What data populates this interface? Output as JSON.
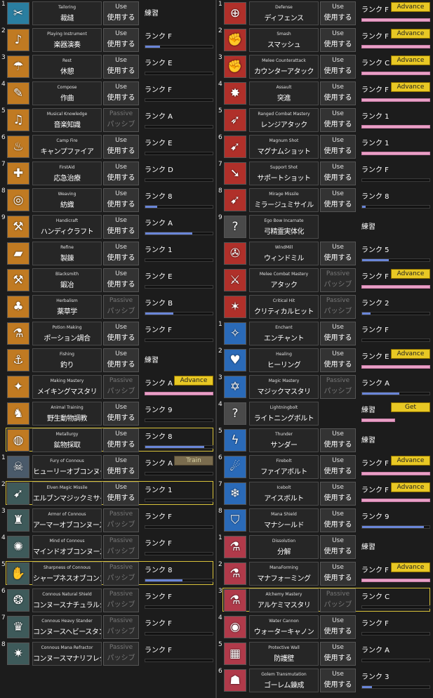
{
  "left": [
    {
      "num": "1",
      "icon": "scissors-icon",
      "glyph": "✂",
      "bg": "#2a7ea0",
      "en": "Tailoring",
      "jp": "裁縫",
      "use_en": "Use",
      "use_jp": "使用する",
      "passive": false,
      "rank": "練習",
      "progress": 0.0,
      "bar": "none",
      "button": ""
    },
    {
      "num": "2",
      "icon": "lute-icon",
      "glyph": "♪",
      "bg": "#c07a22",
      "en": "Playing Instrument",
      "jp": "楽器演奏",
      "use_en": "Use",
      "use_jp": "使用する",
      "passive": false,
      "rank": "ランク F",
      "progress": 0.22,
      "bar": "blue",
      "button": ""
    },
    {
      "num": "3",
      "icon": "rest-umbrella-icon",
      "glyph": "☂",
      "bg": "#c07a22",
      "en": "Rest",
      "jp": "休憩",
      "use_en": "Use",
      "use_jp": "使用する",
      "passive": false,
      "rank": "ランク E",
      "progress": 0.0,
      "bar": "blue",
      "button": ""
    },
    {
      "num": "4",
      "icon": "compose-quill-icon",
      "glyph": "✎",
      "bg": "#c07a22",
      "en": "Compose",
      "jp": "作曲",
      "use_en": "Use",
      "use_jp": "使用する",
      "passive": false,
      "rank": "ランク F",
      "progress": 0.0,
      "bar": "blue",
      "button": ""
    },
    {
      "num": "5",
      "icon": "music-scroll-icon",
      "glyph": "♫",
      "bg": "#c07a22",
      "en": "Musical Knowledge",
      "jp": "音楽知識",
      "use_en": "Passive",
      "use_jp": "パッシブ",
      "passive": true,
      "rank": "ランク A",
      "progress": 0.0,
      "bar": "blue",
      "button": ""
    },
    {
      "num": "6",
      "icon": "campfire-icon",
      "glyph": "♨",
      "bg": "#c07a22",
      "en": "Camp Fire",
      "jp": "キャンプファイア",
      "use_en": "Use",
      "use_jp": "使用する",
      "passive": false,
      "rank": "ランク E",
      "progress": 0.0,
      "bar": "blue",
      "button": ""
    },
    {
      "num": "7",
      "icon": "bandage-icon",
      "glyph": "✚",
      "bg": "#c07a22",
      "en": "FirstAid",
      "jp": "応急治療",
      "use_en": "Use",
      "use_jp": "使用する",
      "passive": false,
      "rank": "ランク D",
      "progress": 0.0,
      "bar": "blue",
      "button": ""
    },
    {
      "num": "8",
      "icon": "yarn-ball-icon",
      "glyph": "◎",
      "bg": "#c07a22",
      "en": "Weaving",
      "jp": "紡織",
      "use_en": "Use",
      "use_jp": "使用する",
      "passive": false,
      "rank": "ランク 8",
      "progress": 0.18,
      "bar": "blue",
      "button": ""
    },
    {
      "num": "9",
      "icon": "handicraft-icon",
      "glyph": "⚒",
      "bg": "#c07a22",
      "en": "Handicraft",
      "jp": "ハンディクラフト",
      "use_en": "Use",
      "use_jp": "使用する",
      "passive": false,
      "rank": "ランク A",
      "progress": 0.7,
      "bar": "blue",
      "button": ""
    },
    {
      "num": "",
      "icon": "refine-ingot-icon",
      "glyph": "▰",
      "bg": "#c07a22",
      "en": "Refine",
      "jp": "製錬",
      "use_en": "Use",
      "use_jp": "使用する",
      "passive": false,
      "rank": "ランク 1",
      "progress": 0.0,
      "bar": "blue",
      "button": ""
    },
    {
      "num": "",
      "icon": "anvil-icon",
      "glyph": "⚒",
      "bg": "#c07a22",
      "en": "Blacksmith",
      "jp": "鍛冶",
      "use_en": "Use",
      "use_jp": "使用する",
      "passive": false,
      "rank": "ランク E",
      "progress": 0.0,
      "bar": "blue",
      "button": ""
    },
    {
      "num": "",
      "icon": "herb-clover-icon",
      "glyph": "♣",
      "bg": "#c07a22",
      "en": "Herbalism",
      "jp": "薬草学",
      "use_en": "Passive",
      "use_jp": "パッシブ",
      "passive": true,
      "rank": "ランク B",
      "progress": 0.42,
      "bar": "blue",
      "button": ""
    },
    {
      "num": "",
      "icon": "potion-flask-icon",
      "glyph": "⚗",
      "bg": "#c07a22",
      "en": "Potion Making",
      "jp": "ポーション調合",
      "use_en": "Use",
      "use_jp": "使用する",
      "passive": false,
      "rank": "ランク F",
      "progress": 0.0,
      "bar": "blue",
      "button": ""
    },
    {
      "num": "",
      "icon": "fishing-rod-icon",
      "glyph": "⚓",
      "bg": "#c07a22",
      "en": "Fishing",
      "jp": "釣り",
      "use_en": "Use",
      "use_jp": "使用する",
      "passive": false,
      "rank": "練習",
      "progress": 0.0,
      "bar": "none",
      "button": ""
    },
    {
      "num": "",
      "icon": "making-tools-icon",
      "glyph": "✦",
      "bg": "#c07a22",
      "en": "Making Mastery",
      "jp": "メイキングマスタリ",
      "use_en": "Passive",
      "use_jp": "パッシブ",
      "passive": true,
      "rank": "ランク A",
      "progress": 0.0,
      "bar": "pink",
      "button": "Advance"
    },
    {
      "num": "",
      "icon": "animal-dog-icon",
      "glyph": "♞",
      "bg": "#c07a22",
      "en": "Animal Training",
      "jp": "野生動物調教",
      "use_en": "Use",
      "use_jp": "使用する",
      "passive": false,
      "rank": "ランク 9",
      "progress": 0.0,
      "bar": "blue",
      "button": ""
    },
    {
      "num": "",
      "icon": "metallurgy-sieve-icon",
      "glyph": "◍",
      "bg": "#c07a22",
      "en": "Metallurgy",
      "jp": "鉱物採取",
      "use_en": "Use",
      "use_jp": "使用する",
      "passive": false,
      "rank": "ランク 8",
      "progress": 0.88,
      "bar": "blue",
      "button": "",
      "hl": true
    },
    {
      "num": "1",
      "icon": "fury-beast-icon",
      "glyph": "☠",
      "bg": "#4a5a6a",
      "en": "Fury of Connous",
      "jp": "ヒューリーオブコンヌース",
      "use_en": "Use",
      "use_jp": "使用する",
      "passive": false,
      "rank": "ランク A",
      "progress": 0.0,
      "bar": "blue",
      "button": "Train"
    },
    {
      "num": "2",
      "icon": "elven-missile-icon",
      "glyph": "➹",
      "bg": "#3e5a5a",
      "en": "Elven Magic Missile",
      "jp": "エルブンマジックミサイル",
      "use_en": "Use",
      "use_jp": "使用する",
      "passive": false,
      "rank": "ランク 1",
      "progress": 0.0,
      "bar": "blue",
      "button": "",
      "hl": true
    },
    {
      "num": "3",
      "icon": "armor-connous-icon",
      "glyph": "♜",
      "bg": "#3e5a5a",
      "en": "Armor of Connous",
      "jp": "アーマーオブコンヌース",
      "use_en": "Passive",
      "use_jp": "パッシブ",
      "passive": true,
      "rank": "ランク F",
      "progress": 0.0,
      "bar": "blue",
      "button": ""
    },
    {
      "num": "4",
      "icon": "mind-connous-icon",
      "glyph": "✺",
      "bg": "#3e5a5a",
      "en": "Mind of Connous",
      "jp": "マインドオブコンヌース",
      "use_en": "Passive",
      "use_jp": "パッシブ",
      "passive": true,
      "rank": "ランク F",
      "progress": 0.0,
      "bar": "blue",
      "button": ""
    },
    {
      "num": "5",
      "icon": "sharpness-claw-icon",
      "glyph": "✋",
      "bg": "#3e5a5a",
      "en": "Sharpness of Connous",
      "jp": "シャープネスオブコンヌース",
      "use_en": "Passive",
      "use_jp": "パッシブ",
      "passive": true,
      "rank": "ランク 8",
      "progress": 0.55,
      "bar": "blue",
      "button": "",
      "hl": true
    },
    {
      "num": "6",
      "icon": "natural-shield-icon",
      "glyph": "❂",
      "bg": "#3e5a5a",
      "en": "Connous Natural Shield",
      "jp": "コンヌースナチュラルシールド",
      "use_en": "Passive",
      "use_jp": "パッシブ",
      "passive": true,
      "rank": "ランク F",
      "progress": 0.0,
      "bar": "blue",
      "button": ""
    },
    {
      "num": "7",
      "icon": "heavy-stander-icon",
      "glyph": "♛",
      "bg": "#3e5a5a",
      "en": "Connous Heavy Stander",
      "jp": "コンヌースヘビースタンダード",
      "use_en": "Passive",
      "use_jp": "パッシブ",
      "passive": true,
      "rank": "ランク F",
      "progress": 0.0,
      "bar": "blue",
      "button": ""
    },
    {
      "num": "8",
      "icon": "mana-reflector-icon",
      "glyph": "✷",
      "bg": "#3e5a5a",
      "en": "Connous Mana Refractor",
      "jp": "コンヌースマナリフレクター",
      "use_en": "Passive",
      "use_jp": "パッシブ",
      "passive": true,
      "rank": "ランク F",
      "progress": 0.0,
      "bar": "blue",
      "button": ""
    }
  ],
  "right": [
    {
      "num": "1",
      "icon": "defense-shield-icon",
      "glyph": "⊕",
      "bg": "#b0302a",
      "en": "Defense",
      "jp": "ディフェンス",
      "use_en": "Use",
      "use_jp": "使用する",
      "passive": false,
      "rank": "ランク F",
      "progress": 0.0,
      "bar": "pink",
      "button": "Advance"
    },
    {
      "num": "2",
      "icon": "smash-fist-icon",
      "glyph": "✊",
      "bg": "#b0302a",
      "en": "Smash",
      "jp": "スマッシュ",
      "use_en": "Use",
      "use_jp": "使用する",
      "passive": false,
      "rank": "ランク F",
      "progress": 0.0,
      "bar": "pink",
      "button": "Advance"
    },
    {
      "num": "3",
      "icon": "counterattack-fist-icon",
      "glyph": "✊",
      "bg": "#b0302a",
      "en": "Melee Counterattack",
      "jp": "カウンターアタック",
      "use_en": "Use",
      "use_jp": "使用する",
      "passive": false,
      "rank": "ランク C",
      "progress": 0.0,
      "bar": "pink",
      "button": "Advance"
    },
    {
      "num": "4",
      "icon": "assault-burst-icon",
      "glyph": "✸",
      "bg": "#b0302a",
      "en": "Assault",
      "jp": "突進",
      "use_en": "Use",
      "use_jp": "使用する",
      "passive": false,
      "rank": "ランク F",
      "progress": 0.0,
      "bar": "pink",
      "button": "Advance"
    },
    {
      "num": "5",
      "icon": "bow-icon",
      "glyph": "➶",
      "bg": "#b0302a",
      "en": "Ranged Combat Mastery",
      "jp": "レンジアタック",
      "use_en": "Use",
      "use_jp": "使用する",
      "passive": false,
      "rank": "ランク 1",
      "progress": 0.0,
      "bar": "pink",
      "button": ""
    },
    {
      "num": "6",
      "icon": "magnum-arrow-icon",
      "glyph": "➹",
      "bg": "#b0302a",
      "en": "Magnum Shot",
      "jp": "マグナムショット",
      "use_en": "Use",
      "use_jp": "使用する",
      "passive": false,
      "rank": "ランク 1",
      "progress": 0.0,
      "bar": "pink",
      "button": ""
    },
    {
      "num": "7",
      "icon": "support-arrow-icon",
      "glyph": "➘",
      "bg": "#b0302a",
      "en": "Support Shot",
      "jp": "サポートショット",
      "use_en": "Use",
      "use_jp": "使用する",
      "passive": false,
      "rank": "ランク F",
      "progress": 0.0,
      "bar": "blue",
      "button": ""
    },
    {
      "num": "8",
      "icon": "mirage-missile-icon",
      "glyph": "➹",
      "bg": "#b0302a",
      "en": "Mirage Missile",
      "jp": "ミラージュミサイル",
      "use_en": "Use",
      "use_jp": "使用する",
      "passive": false,
      "rank": "ランク 8",
      "progress": 0.05,
      "bar": "blue",
      "button": ""
    },
    {
      "num": "9",
      "icon": "question-mark-icon",
      "glyph": "?",
      "bg": "#4a4a4a",
      "en": "Ego Bow Incarnate",
      "jp": "弓精霊実体化",
      "use_en": "",
      "use_jp": "",
      "passive": false,
      "rank": "練習",
      "progress": 0.0,
      "bar": "none",
      "button": "",
      "nouse": true
    },
    {
      "num": "",
      "icon": "windmill-icon",
      "glyph": "✇",
      "bg": "#b0302a",
      "en": "WindMill",
      "jp": "ウィンドミル",
      "use_en": "Use",
      "use_jp": "使用する",
      "passive": false,
      "rank": "ランク 5",
      "progress": 0.4,
      "bar": "blue",
      "button": ""
    },
    {
      "num": "",
      "icon": "crossed-swords-icon",
      "glyph": "⚔",
      "bg": "#b0302a",
      "en": "Melee Combat Mastery",
      "jp": "アタック",
      "use_en": "Passive",
      "use_jp": "パッシブ",
      "passive": true,
      "rank": "ランク F",
      "progress": 0.0,
      "bar": "pink",
      "button": "Advance"
    },
    {
      "num": "",
      "icon": "critical-hit-icon",
      "glyph": "✶",
      "bg": "#b0302a",
      "en": "Critical Hit",
      "jp": "クリティカルヒット",
      "use_en": "Passive",
      "use_jp": "パッシブ",
      "passive": true,
      "rank": "ランク 2",
      "progress": 0.12,
      "bar": "blue",
      "button": ""
    },
    {
      "num": "1",
      "icon": "enchant-sparkle-icon",
      "glyph": "✧",
      "bg": "#2a6ab8",
      "en": "Enchant",
      "jp": "エンチャント",
      "use_en": "Use",
      "use_jp": "使用する",
      "passive": false,
      "rank": "ランク F",
      "progress": 0.0,
      "bar": "blue",
      "button": ""
    },
    {
      "num": "2",
      "icon": "healing-heart-icon",
      "glyph": "♥",
      "bg": "#2a6ab8",
      "en": "Healing",
      "jp": "ヒーリング",
      "use_en": "Use",
      "use_jp": "使用する",
      "passive": false,
      "rank": "ランク E",
      "progress": 0.0,
      "bar": "pink",
      "button": "Advance"
    },
    {
      "num": "3",
      "icon": "hexagram-icon",
      "glyph": "✡",
      "bg": "#2a6ab8",
      "en": "Magic Mastery",
      "jp": "マジックマスタリ",
      "use_en": "Passive",
      "use_jp": "パッシブ",
      "passive": true,
      "rank": "ランク A",
      "progress": 0.55,
      "bar": "blue",
      "button": ""
    },
    {
      "num": "4",
      "icon": "question-mark-icon",
      "glyph": "?",
      "bg": "#4a4a4a",
      "en": "Lightningbolt",
      "jp": "ライトニングボルト",
      "use_en": "",
      "use_jp": "",
      "passive": false,
      "rank": "練習",
      "progress": 0.0,
      "bar": "pinksmall",
      "button": "Get",
      "nouse": true
    },
    {
      "num": "5",
      "icon": "thunder-icon",
      "glyph": "ϟ",
      "bg": "#2a6ab8",
      "en": "Thunder",
      "jp": "サンダー",
      "use_en": "Use",
      "use_jp": "使用する",
      "passive": false,
      "rank": "練習",
      "progress": 0.0,
      "bar": "none",
      "button": ""
    },
    {
      "num": "6",
      "icon": "firebolt-icon",
      "glyph": "☄",
      "bg": "#2a6ab8",
      "en": "Firebolt",
      "jp": "ファイアボルト",
      "use_en": "Use",
      "use_jp": "使用する",
      "passive": false,
      "rank": "ランク F",
      "progress": 0.0,
      "bar": "pink",
      "button": "Advance"
    },
    {
      "num": "7",
      "icon": "icebolt-icon",
      "glyph": "❄",
      "bg": "#2a6ab8",
      "en": "Icebolt",
      "jp": "アイスボルト",
      "use_en": "Use",
      "use_jp": "使用する",
      "passive": false,
      "rank": "ランク F",
      "progress": 0.0,
      "bar": "pink",
      "button": "Advance"
    },
    {
      "num": "8",
      "icon": "mana-shield-icon",
      "glyph": "⛉",
      "bg": "#2a6ab8",
      "en": "Mana Shield",
      "jp": "マナシールド",
      "use_en": "Use",
      "use_jp": "使用する",
      "passive": false,
      "rank": "ランク 9",
      "progress": 0.92,
      "bar": "blue",
      "button": ""
    },
    {
      "num": "1",
      "icon": "dissolution-flask-icon",
      "glyph": "⚗",
      "bg": "#b03a4a",
      "en": "Dissolution",
      "jp": "分解",
      "use_en": "Use",
      "use_jp": "使用する",
      "passive": false,
      "rank": "練習",
      "progress": 0.0,
      "bar": "none",
      "button": ""
    },
    {
      "num": "2",
      "icon": "manaforming-flask-icon",
      "glyph": "⚗",
      "bg": "#b03a4a",
      "en": "ManaForming",
      "jp": "マナフォーミング",
      "use_en": "Use",
      "use_jp": "使用する",
      "passive": false,
      "rank": "ランク F",
      "progress": 0.0,
      "bar": "pink",
      "button": "Advance"
    },
    {
      "num": "3",
      "icon": "alchemy-flask-icon",
      "glyph": "⚗",
      "bg": "#b03a4a",
      "en": "Alchemy Mastery",
      "jp": "アルケミマスタリ",
      "use_en": "Passive",
      "use_jp": "パッシブ",
      "passive": true,
      "rank": "ランク C",
      "progress": 0.0,
      "bar": "blue",
      "button": "",
      "hl": true
    },
    {
      "num": "4",
      "icon": "water-cannon-icon",
      "glyph": "◉",
      "bg": "#b03a4a",
      "en": "Water Cannon",
      "jp": "ウォーターキャノン",
      "use_en": "Use",
      "use_jp": "使用する",
      "passive": false,
      "rank": "ランク F",
      "progress": 0.0,
      "bar": "blue",
      "button": ""
    },
    {
      "num": "5",
      "icon": "protective-wall-icon",
      "glyph": "▦",
      "bg": "#b03a4a",
      "en": "Protective Wall",
      "jp": "防護壁",
      "use_en": "Use",
      "use_jp": "使用する",
      "passive": false,
      "rank": "ランク A",
      "progress": 0.0,
      "bar": "blue",
      "button": ""
    },
    {
      "num": "6",
      "icon": "golem-icon",
      "glyph": "☗",
      "bg": "#b03a4a",
      "en": "Golem Transmutation",
      "jp": "ゴーレム錬成",
      "use_en": "Use",
      "use_jp": "使用する",
      "passive": false,
      "rank": "ランク 3",
      "progress": 0.15,
      "bar": "blue",
      "button": ""
    }
  ]
}
